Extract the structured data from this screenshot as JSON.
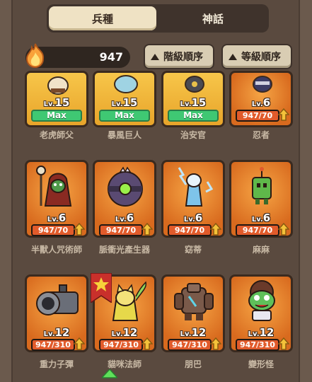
{
  "tabs": [
    {
      "label": "兵種",
      "active": true
    },
    {
      "label": "神話",
      "active": false
    }
  ],
  "resource": {
    "value": "947",
    "icon": "flame-icon"
  },
  "sort_buttons": [
    {
      "label": "階級順序",
      "icon": "triangle-up-icon"
    },
    {
      "label": "等級順序",
      "icon": "triangle-up-icon"
    }
  ],
  "units": [
    {
      "name": "老虎師父",
      "level_prefix": "Lv.",
      "level": "15",
      "status": "Max",
      "rarity": "gold"
    },
    {
      "name": "暴風巨人",
      "level_prefix": "Lv.",
      "level": "15",
      "status": "Max",
      "rarity": "gold"
    },
    {
      "name": "治安官",
      "level_prefix": "Lv.",
      "level": "15",
      "status": "Max",
      "rarity": "gold"
    },
    {
      "name": "忍者",
      "level_prefix": "Lv.",
      "level": "6",
      "progress": "947/70",
      "progress_fraction": 1.0,
      "rarity": "orange"
    },
    {
      "name": "半獸人咒術師",
      "level_prefix": "Lv.",
      "level": "6",
      "progress": "947/70",
      "progress_fraction": 1.0,
      "rarity": "orange"
    },
    {
      "name": "脈衝光產生器",
      "level_prefix": "Lv.",
      "level": "6",
      "progress": "947/70",
      "progress_fraction": 1.0,
      "rarity": "orange"
    },
    {
      "name": "窈蒂",
      "level_prefix": "Lv.",
      "level": "6",
      "progress": "947/70",
      "progress_fraction": 1.0,
      "rarity": "orange"
    },
    {
      "name": "麻麻",
      "level_prefix": "Lv.",
      "level": "6",
      "progress": "947/70",
      "progress_fraction": 1.0,
      "rarity": "orange"
    },
    {
      "name": "重力子彈",
      "level_prefix": "Lv.",
      "level": "12",
      "progress": "947/310",
      "progress_fraction": 1.0,
      "rarity": "orange"
    },
    {
      "name": "貓咪法師",
      "level_prefix": "Lv.",
      "level": "12",
      "progress": "947/310",
      "progress_fraction": 1.0,
      "rarity": "orange",
      "starred": true
    },
    {
      "name": "朋巴",
      "level_prefix": "Lv.",
      "level": "12",
      "progress": "947/310",
      "progress_fraction": 1.0,
      "rarity": "orange"
    },
    {
      "name": "變形怪",
      "level_prefix": "Lv.",
      "level": "12",
      "progress": "947/310",
      "progress_fraction": 1.0,
      "rarity": "orange"
    }
  ],
  "colors": {
    "max_bar": "#3fc873",
    "progress_fill": "#e15b2b",
    "card_gold": "#f7c64a",
    "card_orange": "#e8842f"
  }
}
